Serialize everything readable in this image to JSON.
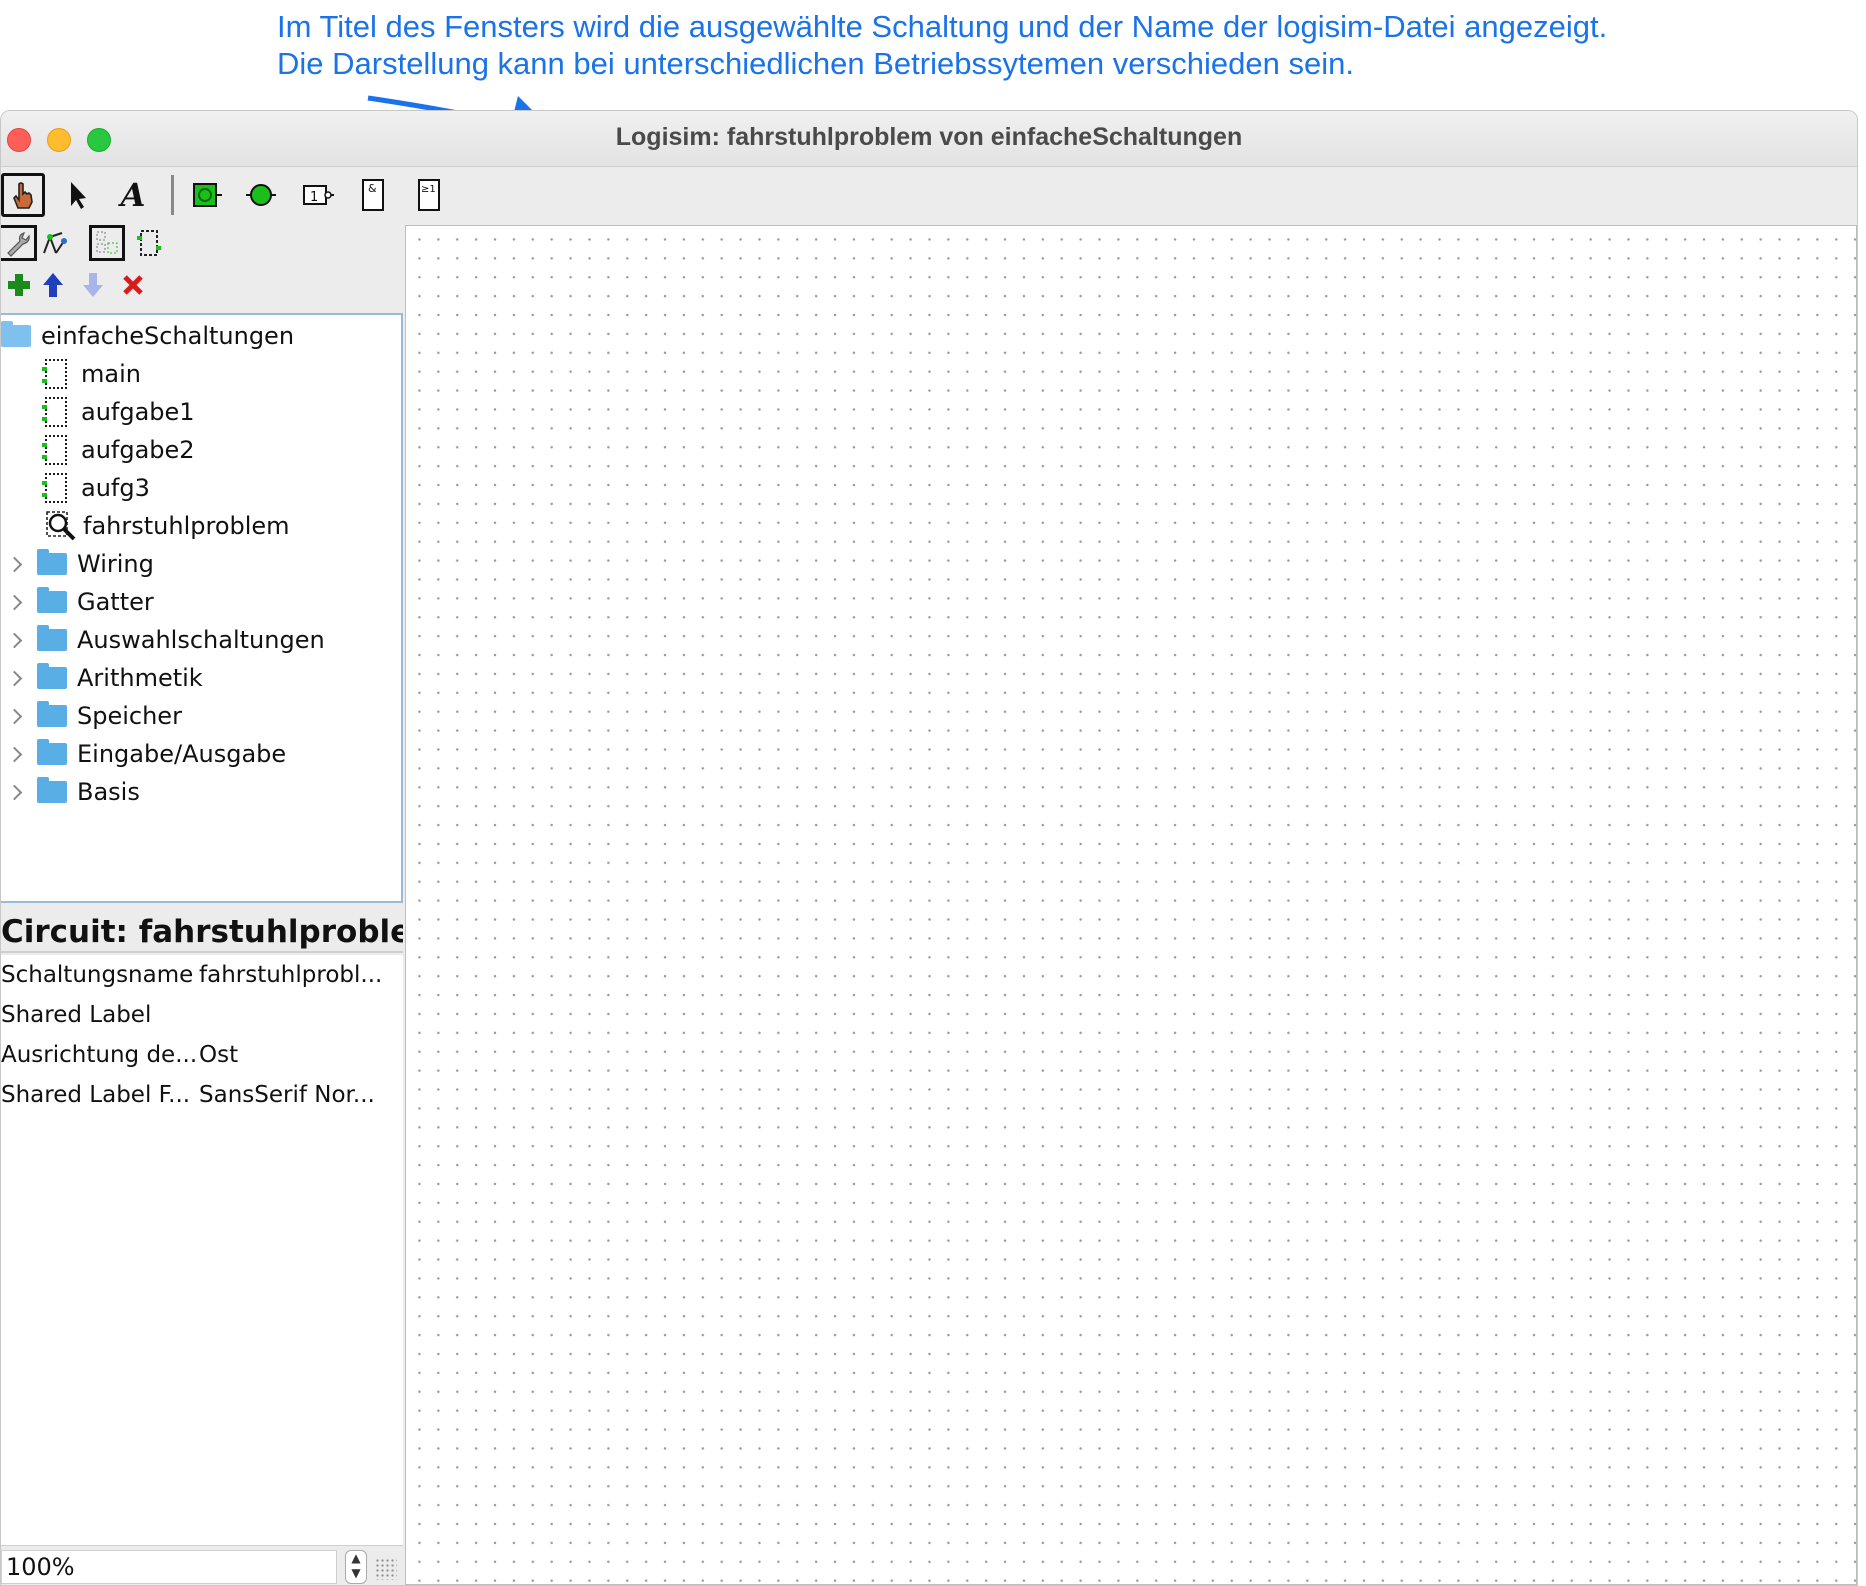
{
  "annotation": {
    "line1": "Im Titel des Fensters wird die ausgewählte Schaltung und der Name der logisim-Datei angezeigt.",
    "line2": "Die Darstellung kann bei unterschiedlichen Betriebssytemen verschieden sein."
  },
  "window": {
    "title": "Logisim: fahrstuhlproblem von einfacheSchaltungen"
  },
  "toolbar": {
    "tools": [
      "hand-poke-tool",
      "select-tool",
      "text-tool",
      "input-pin",
      "output-pin",
      "not-gate",
      "and-gate",
      "or-gate"
    ],
    "and_label": "&",
    "or_label": "≥1",
    "not_label": "1",
    "text_label": "A"
  },
  "tree": {
    "root": "einfacheSchaltungen",
    "circuits": [
      "main",
      "aufgabe1",
      "aufgabe2",
      "aufg3",
      "fahrstuhlproblem"
    ],
    "libraries": [
      "Wiring",
      "Gatter",
      "Auswahlschaltungen",
      "Arithmetik",
      "Speicher",
      "Eingabe/Ausgabe",
      "Basis"
    ]
  },
  "attributes": {
    "header": "Circuit: fahrstuhlproble...",
    "rows": [
      {
        "key": "Schaltungsname",
        "value": "fahrstuhlprobl..."
      },
      {
        "key": "Shared Label",
        "value": ""
      },
      {
        "key": "Ausrichtung de...",
        "value": "Ost"
      },
      {
        "key": "Shared Label F...",
        "value": "SansSerif Nor..."
      }
    ]
  },
  "zoom": {
    "value": "100%"
  },
  "colors": {
    "annotation": "#1a73e8",
    "accent_green": "#1bbf1b",
    "folder_blue": "#5aaee6"
  }
}
